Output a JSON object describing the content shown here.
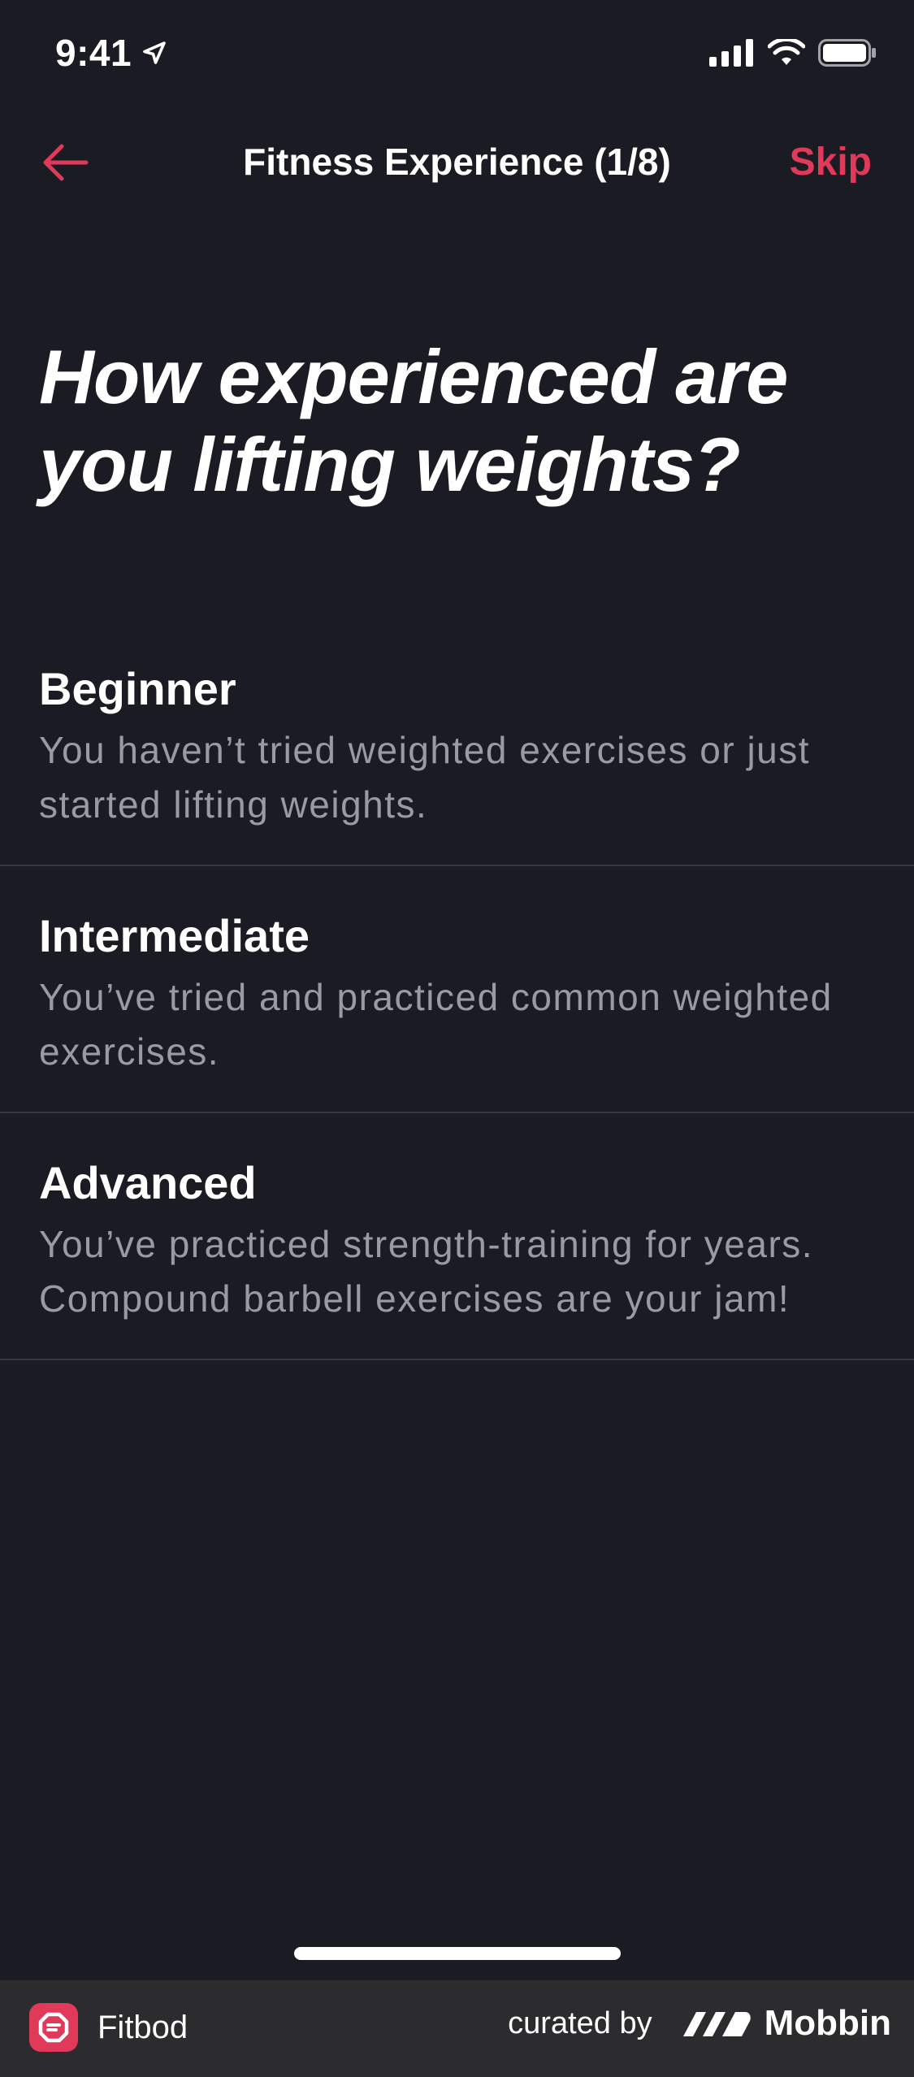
{
  "status_bar": {
    "time": "9:41"
  },
  "nav": {
    "title": "Fitness Experience (1/8)",
    "skip_label": "Skip",
    "accent_color": "#e0395a"
  },
  "question": {
    "text": "How experienced are you lifting weights?"
  },
  "options": [
    {
      "title": "Beginner",
      "description": "You haven’t tried weighted exercises or just started lifting weights."
    },
    {
      "title": "Intermediate",
      "description": "You’ve tried and practiced common weighted exercises."
    },
    {
      "title": "Advanced",
      "description": "You’ve practiced strength-training for years. Compound barbell exercises are your jam!"
    }
  ],
  "footer": {
    "app_name": "Fitbod",
    "curated_by": "curated by",
    "brand_name": "Mobbin"
  },
  "icons": {
    "back": "arrow-left-icon",
    "location": "location-arrow-icon",
    "signal": "cellular-signal-icon",
    "wifi": "wifi-icon",
    "battery": "battery-icon",
    "app_logo": "fitbod-logo-icon",
    "brand_logo": "mobbin-logo-icon"
  },
  "colors": {
    "background": "#1b1b24",
    "accent": "#e0395a",
    "secondary_text": "#9a9aa6",
    "divider": "#383843",
    "footer_background": "#2c2c2e"
  }
}
